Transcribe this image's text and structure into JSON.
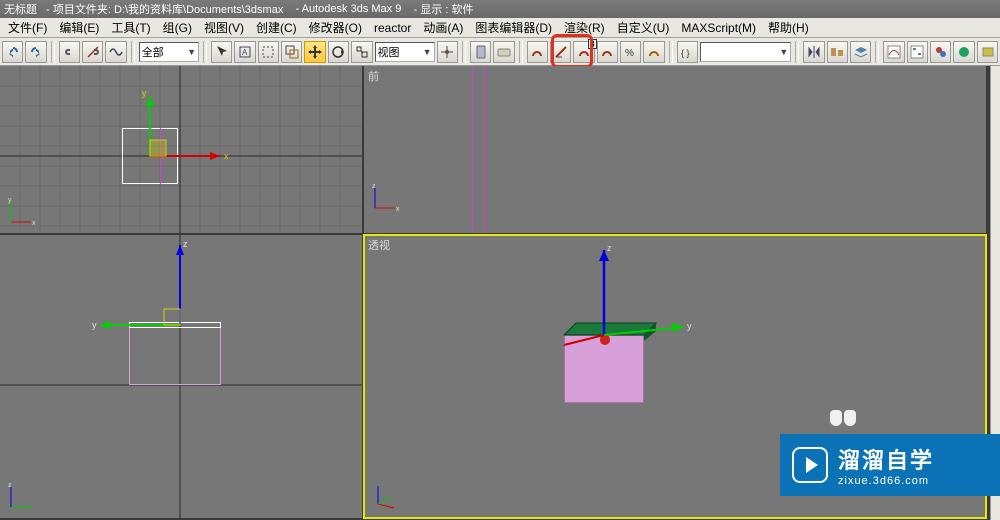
{
  "title": {
    "untitled": "无标题",
    "project": "- 项目文件夹: D:\\我的资料库\\Documents\\3dsmax",
    "app": "- Autodesk 3ds Max 9",
    "display": "- 显示 : 软件"
  },
  "menu": {
    "file": "文件(F)",
    "edit": "编辑(E)",
    "tools": "工具(T)",
    "group": "组(G)",
    "views": "视图(V)",
    "create": "创建(C)",
    "modifiers": "修改器(O)",
    "reactor": "reactor",
    "animation": "动画(A)",
    "graph": "图表编辑器(D)",
    "render": "渲染(R)",
    "customize": "自定义(U)",
    "maxscript": "MAXScript(M)",
    "help": "帮助(H)"
  },
  "toolbar": {
    "filter_combo": "全部",
    "view_combo": "视图",
    "layer_combo": "",
    "snap3_badge": "3"
  },
  "viewports": {
    "front_label": "前",
    "persp_label": "透视"
  },
  "axis_labels": {
    "x": "x",
    "y": "y",
    "z": "z"
  },
  "watermark": {
    "brand": "溜溜自学",
    "domain": "zixue.3d66.com"
  },
  "icons": {
    "undo": "undo-icon",
    "redo": "redo-icon",
    "link": "link-icon",
    "unlink": "unlink-icon",
    "select": "select-arrow",
    "rect": "select-rect",
    "move": "move-icon",
    "rotate": "rotate-icon",
    "scale": "scale-icon",
    "mirror": "mirror-icon",
    "align": "align-icon",
    "snap": "snap-icon",
    "render": "render-icon"
  }
}
